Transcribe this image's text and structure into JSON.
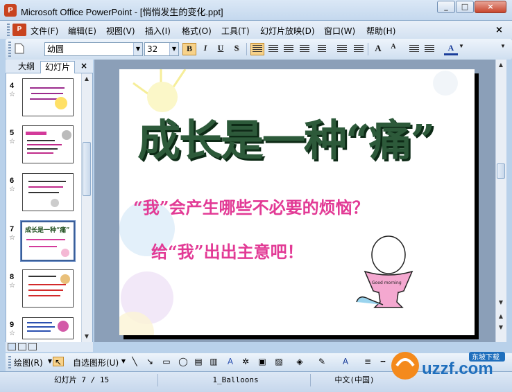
{
  "window": {
    "title": "Microsoft Office PowerPoint - [悄悄发生的变化.ppt]",
    "app_icon_letter": "P",
    "minimize": "_",
    "maximize": "□",
    "close": "×"
  },
  "menu": {
    "items": [
      "文件(F)",
      "编辑(E)",
      "视图(V)",
      "插入(I)",
      "格式(O)",
      "工具(T)",
      "幻灯片放映(D)",
      "窗口(W)",
      "帮助(H)"
    ],
    "close": "×"
  },
  "toolbar": {
    "font_name": "幼圆",
    "font_size": "32",
    "bold": "B",
    "italic": "I",
    "underline": "U",
    "shadow": "S",
    "grow_font": "A",
    "shrink_font": "A",
    "font_color": "A"
  },
  "left_pane": {
    "tabs": [
      "大纲",
      "幻灯片"
    ],
    "selected_tab": "幻灯片",
    "close": "×",
    "thumbnails": [
      {
        "number": "4",
        "star": "☆"
      },
      {
        "number": "5",
        "star": "☆"
      },
      {
        "number": "6",
        "star": "☆"
      },
      {
        "number": "7",
        "star": "☆",
        "title": "成长是一种“痛”",
        "selected": true
      },
      {
        "number": "8",
        "star": "☆"
      },
      {
        "number": "9",
        "star": "☆"
      }
    ]
  },
  "slide": {
    "title": "成长是一种“痛”",
    "line1": "“我”会产生哪些不必要的烦恼？",
    "line2": "给“我”出出主意吧！",
    "egg_cup_text": "Good morning"
  },
  "draw_toolbar": {
    "draw_label": "绘图(R)",
    "autoshape_label": "自选图形(U)"
  },
  "status": {
    "slide_position": "幻灯片 7 / 15",
    "design": "1_Balloons",
    "language": "中文(中国)"
  },
  "watermark": {
    "text": "uzzf.com",
    "tag": "东坡下载"
  }
}
